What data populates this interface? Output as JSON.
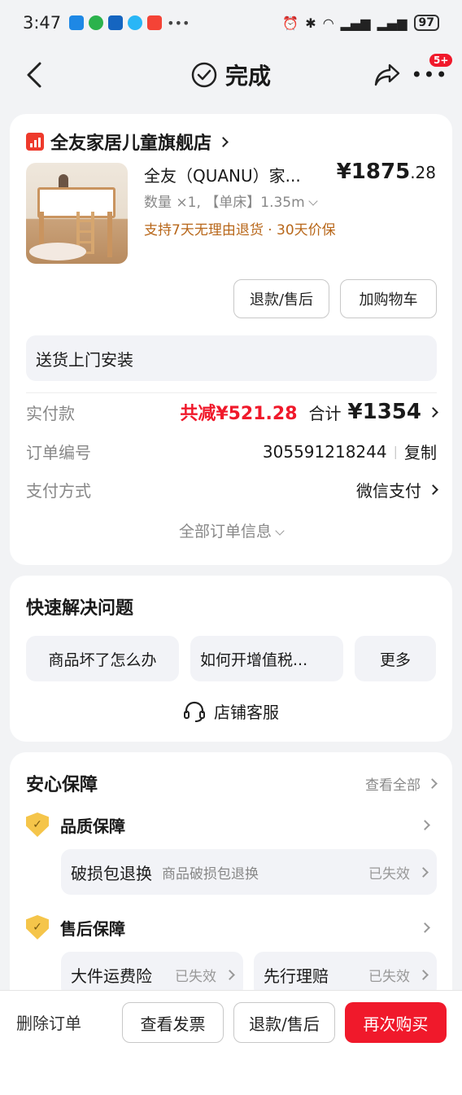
{
  "status_bar": {
    "time": "3:47",
    "battery": "97"
  },
  "header": {
    "title": "完成",
    "badge": "5+"
  },
  "order": {
    "shop_name": "全友家居儿童旗舰店",
    "product_title": "全友（QUANU）家...",
    "price_main": "¥1875",
    "price_decimal": ".28",
    "spec": "数量 ×1, 【单床】1.35m",
    "promise": "支持7天无理由退货 · 30天价保",
    "refund_label": "退款/售后",
    "add_cart_label": "加购物车",
    "install_label": "送货上门安装",
    "paid_label": "实付款",
    "discount": "共减¥521.28",
    "total_label": "合计",
    "total_value": "¥1354",
    "order_no_label": "订单编号",
    "order_no": "305591218244",
    "copy_label": "复制",
    "pay_method_label": "支付方式",
    "pay_method": "微信支付",
    "all_info_label": "全部订单信息"
  },
  "quick": {
    "title": "快速解决问题",
    "chips": [
      "商品坏了怎么办",
      "如何开增值税...",
      "更多"
    ],
    "service_label": "店铺客服"
  },
  "guarantee": {
    "title": "安心保障",
    "view_all": "查看全部",
    "quality_title": "品质保障",
    "quality_item_name": "破损包退换",
    "quality_item_desc": "商品破损包退换",
    "quality_item_status": "已失效",
    "aftersale_title": "售后保障",
    "aftersale_item1_name": "大件运费险",
    "aftersale_item1_status": "已失效",
    "aftersale_item2_name": "先行理赔",
    "aftersale_item2_status": "已失效"
  },
  "bottom_bar": {
    "delete_label": "删除订单",
    "invoice_label": "查看发票",
    "refund_label": "退款/售后",
    "rebuy_label": "再次购买"
  },
  "colors": {
    "accent_red": "#f0192b",
    "promise_orange": "#b8671a",
    "shop_logo": "#ee3a2c"
  }
}
